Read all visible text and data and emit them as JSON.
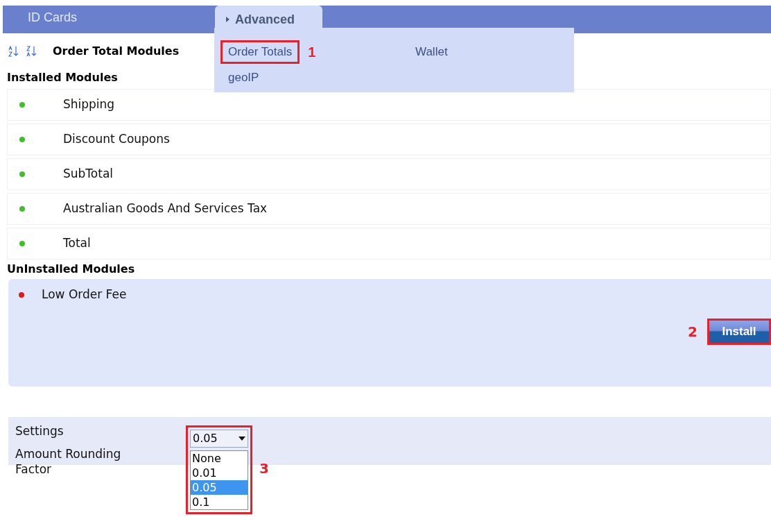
{
  "nav": {
    "items": [
      {
        "label": "ID Cards",
        "selected": false
      },
      {
        "label": "Advanced",
        "selected": true
      }
    ]
  },
  "menu": {
    "items": [
      {
        "label": "Order Totals",
        "callout": "1"
      },
      {
        "label": "Wallet"
      },
      {
        "label": "geoIP"
      }
    ]
  },
  "toolbar": {
    "title": "Order Total Modules"
  },
  "installed": {
    "heading": "Installed Modules",
    "modules": [
      {
        "name": "Shipping",
        "installed": true
      },
      {
        "name": "Discount Coupons",
        "installed": true
      },
      {
        "name": "SubTotal",
        "installed": true
      },
      {
        "name": "Australian Goods And Services Tax",
        "installed": true
      },
      {
        "name": "Total",
        "installed": true
      }
    ]
  },
  "uninstalled": {
    "heading": "UnInstalled Modules",
    "modules": [
      {
        "name": "Low Order Fee",
        "installed": false
      }
    ],
    "install_button": {
      "label": "Install",
      "callout": "2"
    }
  },
  "settings": {
    "heading": "Settings",
    "field_label": "Amount Rounding Factor",
    "select": {
      "value": "0.05",
      "callout": "3",
      "options": [
        {
          "label": "None",
          "selected": false
        },
        {
          "label": "0.01",
          "selected": false
        },
        {
          "label": "0.05",
          "selected": true
        },
        {
          "label": "0.1",
          "selected": false
        }
      ]
    }
  }
}
